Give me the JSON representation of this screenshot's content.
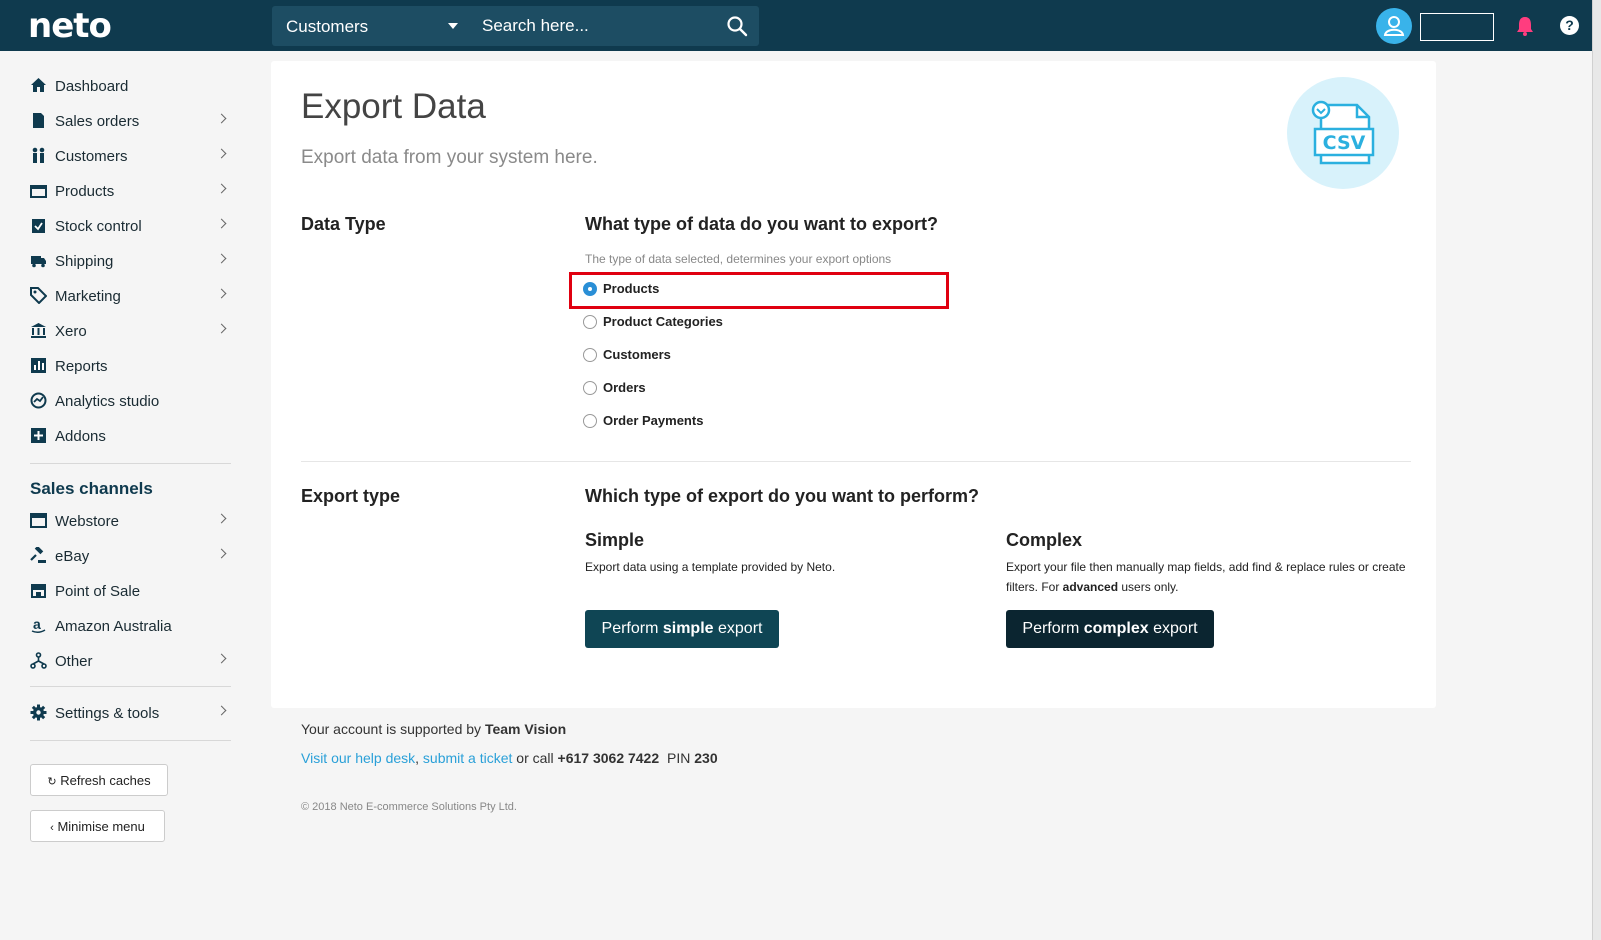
{
  "app": {
    "logo": "neto",
    "accent": "#0f3a4e",
    "link_color": "#2aa0d8"
  },
  "topbar": {
    "search_scope": "Customers",
    "search_placeholder": "Search here...",
    "help_label": "?"
  },
  "sidebar": {
    "items": [
      {
        "label": "Dashboard",
        "icon": "home-icon",
        "has_submenu": false
      },
      {
        "label": "Sales orders",
        "icon": "document-icon",
        "has_submenu": true
      },
      {
        "label": "Customers",
        "icon": "people-icon",
        "has_submenu": true
      },
      {
        "label": "Products",
        "icon": "box-icon",
        "has_submenu": true
      },
      {
        "label": "Stock control",
        "icon": "clipboard-check-icon",
        "has_submenu": true
      },
      {
        "label": "Shipping",
        "icon": "truck-icon",
        "has_submenu": true
      },
      {
        "label": "Marketing",
        "icon": "tag-icon",
        "has_submenu": true
      },
      {
        "label": "Xero",
        "icon": "bank-icon",
        "has_submenu": true
      },
      {
        "label": "Reports",
        "icon": "bar-chart-icon",
        "has_submenu": false
      },
      {
        "label": "Analytics studio",
        "icon": "analytics-icon",
        "has_submenu": false
      },
      {
        "label": "Addons",
        "icon": "plus-square-icon",
        "has_submenu": false
      }
    ],
    "channels_heading": "Sales channels",
    "channels": [
      {
        "label": "Webstore",
        "icon": "browser-icon",
        "has_submenu": true
      },
      {
        "label": "eBay",
        "icon": "gavel-icon",
        "has_submenu": true
      },
      {
        "label": "Point of Sale",
        "icon": "store-icon",
        "has_submenu": false
      },
      {
        "label": "Amazon Australia",
        "icon": "amazon-icon",
        "has_submenu": false
      },
      {
        "label": "Other",
        "icon": "network-icon",
        "has_submenu": true
      }
    ],
    "settings": {
      "label": "Settings & tools",
      "icon": "gear-icon",
      "has_submenu": true
    },
    "refresh_label": "Refresh caches",
    "minimise_label": "Minimise menu"
  },
  "main": {
    "title": "Export Data",
    "subtitle": "Export data from your system here.",
    "badge_text": "CSV",
    "data_type": {
      "label": "Data Type",
      "question": "What type of data do you want to export?",
      "hint": "The type of data selected, determines your export options",
      "options": [
        {
          "label": "Products",
          "selected": true
        },
        {
          "label": "Product Categories",
          "selected": false
        },
        {
          "label": "Customers",
          "selected": false
        },
        {
          "label": "Orders",
          "selected": false
        },
        {
          "label": "Order Payments",
          "selected": false
        }
      ]
    },
    "export_type": {
      "label": "Export type",
      "question": "Which type of export do you want to perform?",
      "simple": {
        "title": "Simple",
        "desc": "Export data using a template provided by Neto.",
        "btn_pre": "Perform ",
        "btn_bold": "simple",
        "btn_post": " export"
      },
      "complex": {
        "title": "Complex",
        "desc_pre": "Export your file then manually map fields, add find & replace rules or create filters. For ",
        "desc_bold": "advanced",
        "desc_post": " users only.",
        "btn_pre": "Perform ",
        "btn_bold": "complex",
        "btn_post": " export"
      }
    }
  },
  "footer": {
    "support_pre": "Your account is supported by ",
    "support_team": "Team Vision",
    "helpdesk_link": "Visit our help desk",
    "comma": ",",
    "ticket_link": "submit a ticket",
    "call_text": " or call ",
    "phone": "+617 3062 7422",
    "pin_label": "PIN",
    "pin": "230",
    "copyright": "© 2018 Neto E-commerce Solutions Pty Ltd."
  }
}
